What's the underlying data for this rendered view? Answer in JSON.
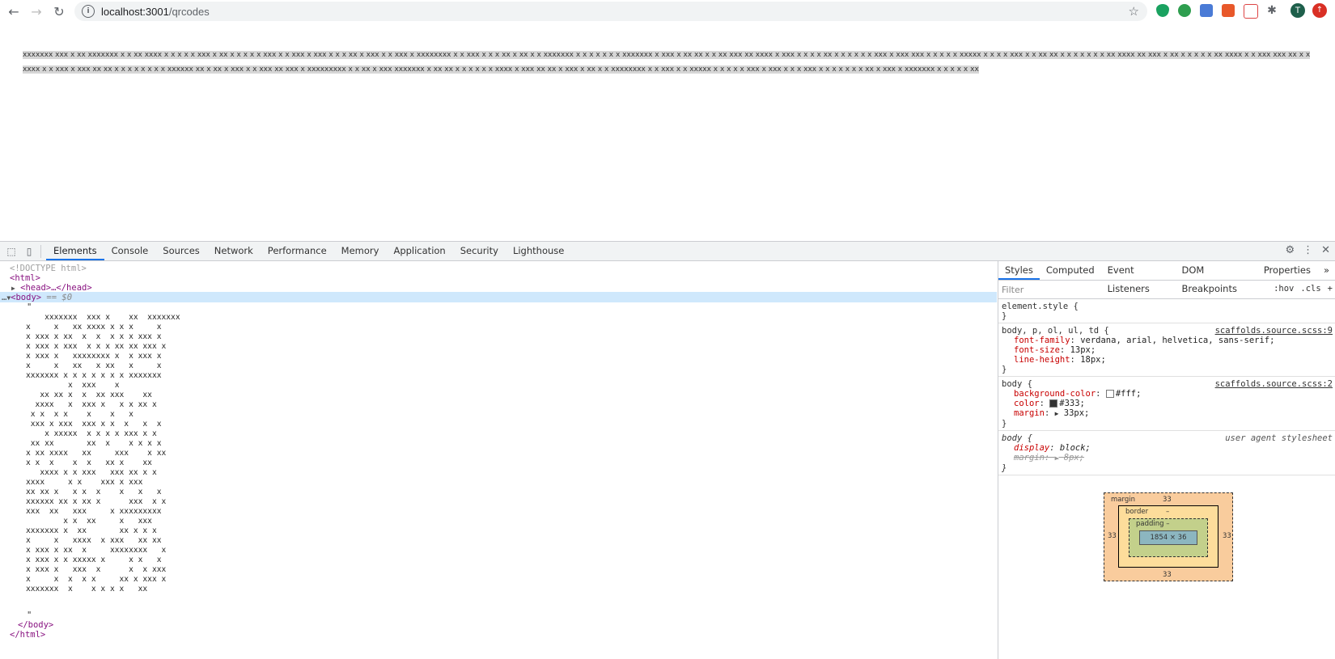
{
  "browser": {
    "url_host": "localhost:3001",
    "url_path": "/qrcodes",
    "avatar_letter": "T"
  },
  "page": {
    "text": "xxxxxxx xxx x xx xxxxxxx x x xx xxxx x x x x x xxx x xx x x x x x xxx x x xxx x xxx x x x xx x xxx x x xxx x xxxxxxxx x x xxx x x x xx x xx x x xxxxxxx x x x x x x x xxxxxxx x xxx x xx xx x x xx xxx xx xxxx x xxx x x x x xx x x x x x x xxx x xxx xxx x x x x x xxxxx x x x x xxx x x xx xx x x x x x x x xx xxxx xx xxx x xx x x x x x xx xxxx x x xxx xxx xx x x xxxx x x xxx x xxx xx xx x x x x x x x x xxxxxx xx x xx x xxx x x xxx xx xxx x xxxxxxxxx x x xx x xxx xxxxxxx x xx xx x x x x x x xxxx x xxx xx xx x xxx x xx x x xxxxxxxx x x xxx x x xxxxx x x x x x xxx x xxx x x x xxx x x x x x x x xx x xxx x xxxxxxx x x x x x xx"
  },
  "devtools": {
    "tabs": [
      "Elements",
      "Console",
      "Sources",
      "Network",
      "Performance",
      "Memory",
      "Application",
      "Security",
      "Lighthouse"
    ],
    "dom": {
      "doctype": "<!DOCTYPE html>",
      "html_open": "<html>",
      "head": "<head>…</head>",
      "body_open": "<body>",
      "body_marker": " == $0",
      "quote_open": "\"",
      "quote_close": "\"",
      "body_close": "</body>",
      "html_close": "</html>"
    },
    "qr_text": "    xxxxxxx  xxx x    xx  xxxxxxx\nx     x   xx xxxx x x x     x\nx xxx x xx  x  x  x x x xxx x\nx xxx x xxx  x x x xx xx xxx x\nx xxx x   xxxxxxxx x  x xxx x\nx     x   xx   x xx   x     x\nxxxxxxx x x x x x x x xxxxxxx\n         x  xxx    x\n   xx xx x  x  xx xxx    xx\n  xxxx   x  xxx x   x x xx x\n x x  x x    x    x   x\n xxx x xxx  xxx x x  x   x  x\n    x xxxxx  x x x x xxx x x\n xx xx       xx  x    x x x x\nx xx xxxx   xx     xxx    x xx\nx x  x    x  x   xx x    xx\n   xxxx x x xxx   xxx xx x x\nxxxx     x x    xxx x xxx\nxx xx x   x x  x    x   x   x\nxxxxxx xx x xx x      xxx  x x\nxxx  xx   xxx     x xxxxxxxxx\n        x x  xx     x   xxx\nxxxxxxx x  xx       xx x x x\nx     x   xxxx  x xxx   xx xx\nx xxx x xx  x     xxxxxxxx   x\nx xxx x x xxxxx x     x x   x\nx xxx x   xxx  x      x  x xxx\nx     x  x  x x     xx x xxx x\nxxxxxxx  x    x x x x   xx",
    "sidebar_tabs": [
      "Styles",
      "Computed",
      "Event Listeners",
      "DOM Breakpoints",
      "Properties"
    ],
    "filter_placeholder": "Filter",
    "filter_hov": ":hov",
    "filter_cls": ".cls",
    "rules": {
      "element_style": "element.style {",
      "r1_selector": "body, p, ol, ul, td {",
      "r1_source": "scaffolds.source.scss:9",
      "r1_p1_name": "font-family",
      "r1_p1_val": "verdana, arial, helvetica, sans-serif;",
      "r1_p2_name": "font-size",
      "r1_p2_val": "13px;",
      "r1_p3_name": "line-height",
      "r1_p3_val": "18px;",
      "r2_selector": "body {",
      "r2_source": "scaffolds.source.scss:2",
      "r2_p1_name": "background-color",
      "r2_p1_val": "#fff;",
      "r2_p2_name": "color",
      "r2_p2_val": "#333;",
      "r2_p3_name": "margin",
      "r2_p3_val": "33px;",
      "r3_selector": "body {",
      "r3_source": "user agent stylesheet",
      "r3_p1_name": "display",
      "r3_p1_val": "block;",
      "r3_p2_name": "margin",
      "r3_p2_val": "8px;"
    },
    "box_model": {
      "margin_label": "margin",
      "margin_top": "33",
      "margin_bottom": "33",
      "margin_left": "33",
      "margin_right": "33",
      "border_label": "border",
      "border_val": "–",
      "padding_label": "padding –",
      "content": "1854 × 36"
    }
  },
  "colors": {
    "accent": "#1a73e8",
    "tag": "#881280",
    "prop": "#c80000"
  }
}
